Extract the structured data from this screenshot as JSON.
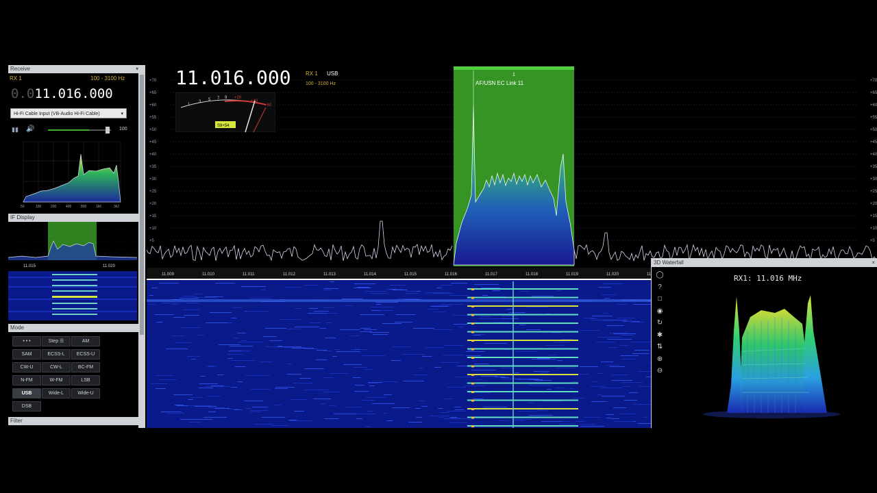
{
  "left_panel": {
    "receive_title": "Receive",
    "rx_label": "RX 1",
    "bandwidth": "100 - 3100 Hz",
    "freq_dim": "0.0",
    "freq_main": "11.016.000",
    "audio_source": "Hi-Fi Cable Input (VB-Audio Hi-Fi Cable)",
    "volume_value": "100",
    "audio_ticks": [
      "50",
      "100",
      "200",
      "400",
      "800",
      "1k6",
      "3k2"
    ],
    "if_display_title": "IF Display",
    "if_ticks": [
      "11.015",
      "11.020"
    ],
    "mode_title": "Mode",
    "mode_buttons": [
      "• • •",
      "Step ☰",
      "AM",
      "SAM",
      "ECSS-L",
      "ECSS-U",
      "CW-U",
      "CW-L",
      "BC-FM",
      "N-FM",
      "W-FM",
      "LSB",
      "USB",
      "Wide-L",
      "Wide-U",
      "DSB"
    ],
    "active_mode": "USB",
    "filter_title": "Filter"
  },
  "main": {
    "frequency": "11.016.000",
    "rx_label": "RX 1",
    "mode": "USB",
    "bandwidth": "100 - 3100 Hz",
    "smeter_reading": "S9+54",
    "smeter_scale": [
      "1",
      "3",
      "5",
      "7",
      "9",
      "+20",
      "+40",
      "+60"
    ],
    "db_scale": [
      "+70",
      "+65",
      "+60",
      "+55",
      "+50",
      "+45",
      "+40",
      "+35",
      "+30",
      "+25",
      "+20",
      "+15",
      "+10",
      "+5"
    ],
    "freq_axis": [
      "11.009",
      "11.010",
      "11.011",
      "11.012",
      "11.013",
      "11.014",
      "11.015",
      "11.016",
      "11.017",
      "11.018",
      "11.019",
      "11.020",
      "11.0"
    ],
    "marker_number": "1",
    "marker_label": "AF/USN EC Link 11"
  },
  "waterfall3d": {
    "title": "3D Waterfall",
    "heading": "RX1: 11.016 MHz",
    "side_icons": [
      "ring-icon",
      "help-icon",
      "square-icon",
      "info-icon",
      "refresh-icon",
      "star-icon",
      "swap-icon",
      "zoom-in-icon",
      "zoom-out-icon"
    ],
    "side_glyphs": [
      "◯",
      "?",
      "□",
      "◉",
      "↻",
      "✱",
      "⇅",
      "⊕",
      "⊖"
    ]
  },
  "colors": {
    "accent_green": "#3fae2a",
    "spectrum_line": "#d6d9f0",
    "waterfall_bg": "#0b1a8a",
    "gold": "#d8b73a"
  }
}
